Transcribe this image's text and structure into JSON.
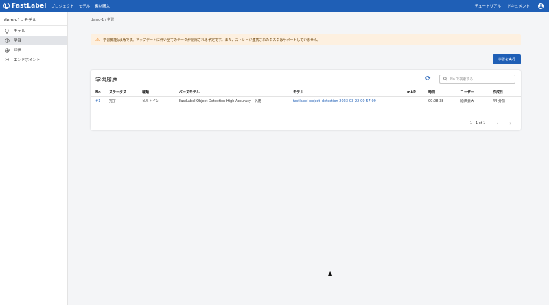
{
  "header": {
    "brand": "FastLabel",
    "nav": [
      "プロジェクト",
      "モデル",
      "素材購入"
    ],
    "tutorial": "チュートリアル",
    "docs": "ドキュメント"
  },
  "sidebar": {
    "title": "demo-1 - モデル",
    "items": [
      {
        "label": "モデル",
        "icon": "bulb-icon"
      },
      {
        "label": "学習",
        "icon": "brain-icon"
      },
      {
        "label": "評価",
        "icon": "scale-icon"
      },
      {
        "label": "エンドポイント",
        "icon": "antenna-icon"
      }
    ]
  },
  "breadcrumb": "demo-1  /  学習",
  "alert": {
    "text": "学習機能はβ版です。アップデートに伴い全てのデータが削除される予定です。また、ストレージ連携されたタスクはサポートしていません。"
  },
  "run_button": "学習を実行",
  "panel": {
    "title": "学習履歴",
    "search_placeholder": "No.で検索する"
  },
  "table": {
    "headers": [
      "No.",
      "ステータス",
      "種類",
      "ベースモデル",
      "モデル",
      "mAP",
      "時間",
      "ユーザー",
      "作成日"
    ],
    "rows": [
      {
        "no": "#1",
        "status": "完了",
        "kind": "ビルトイン",
        "base_model": "FastLabel Object Detection High Accuracy - 汎用",
        "model": "fastlabel_object_detection-2023-03-22-00-57-09",
        "map": "---",
        "time": "00:08:38",
        "user": "原西貴大",
        "created": "44 分前"
      }
    ]
  },
  "pagination": "1 - 1 of 1",
  "colors": {
    "primary": "#1f5fb6",
    "alert_bg": "#fdf0e0",
    "alert_icon": "#ed8a2a"
  }
}
